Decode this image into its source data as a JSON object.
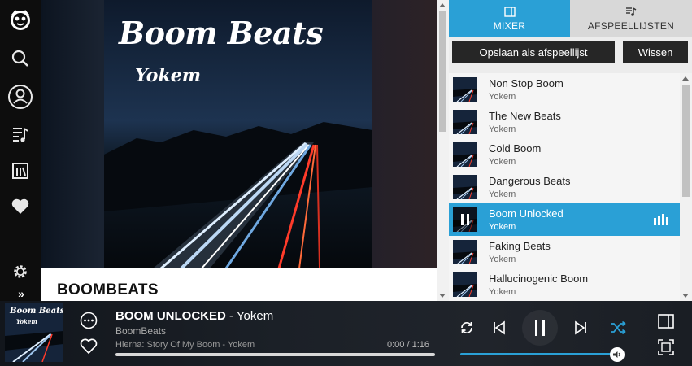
{
  "nav": {
    "items": [
      {
        "name": "napster-logo-icon"
      },
      {
        "name": "search-icon"
      },
      {
        "name": "profile-icon"
      },
      {
        "name": "playlist-icon"
      },
      {
        "name": "library-icon"
      },
      {
        "name": "heart-icon"
      },
      {
        "name": "settings-icon"
      }
    ],
    "expand_label": "»"
  },
  "album": {
    "cover_title": "Boom Beats",
    "cover_artist": "Yokem",
    "heading": "BOOMBEATS"
  },
  "panel": {
    "tabs": [
      {
        "label": "MIXER",
        "icon": "mixer-icon",
        "active": true
      },
      {
        "label": "AFSPEELLIJSTEN",
        "icon": "playlists-icon",
        "active": false
      }
    ],
    "save_label": "Opslaan als afspeellijst",
    "clear_label": "Wissen",
    "queue": [
      {
        "title": "Non Stop Boom",
        "artist": "Yokem",
        "active": false
      },
      {
        "title": "The New Beats",
        "artist": "Yokem",
        "active": false
      },
      {
        "title": "Cold Boom",
        "artist": "Yokem",
        "active": false
      },
      {
        "title": "Dangerous Beats",
        "artist": "Yokem",
        "active": false
      },
      {
        "title": "Boom Unlocked",
        "artist": "Yokem",
        "active": true
      },
      {
        "title": "Faking Beats",
        "artist": "Yokem",
        "active": false
      },
      {
        "title": "Hallucinogenic Boom",
        "artist": "Yokem",
        "active": false
      }
    ]
  },
  "player": {
    "track_title": "BOOM UNLOCKED",
    "separator": " - ",
    "track_artist": "Yokem",
    "album": "BoomBeats",
    "next_up": "Hierna: Story Of My Boom - Yokem",
    "time": "0:00 / 1:16",
    "progress": 0.0,
    "volume": 1.0,
    "cover_title": "Boom Beats",
    "cover_artist": "Yokem"
  },
  "colors": {
    "accent": "#2aa0d6",
    "sidebar": "#0d0d0d",
    "panel": "#ececec"
  }
}
